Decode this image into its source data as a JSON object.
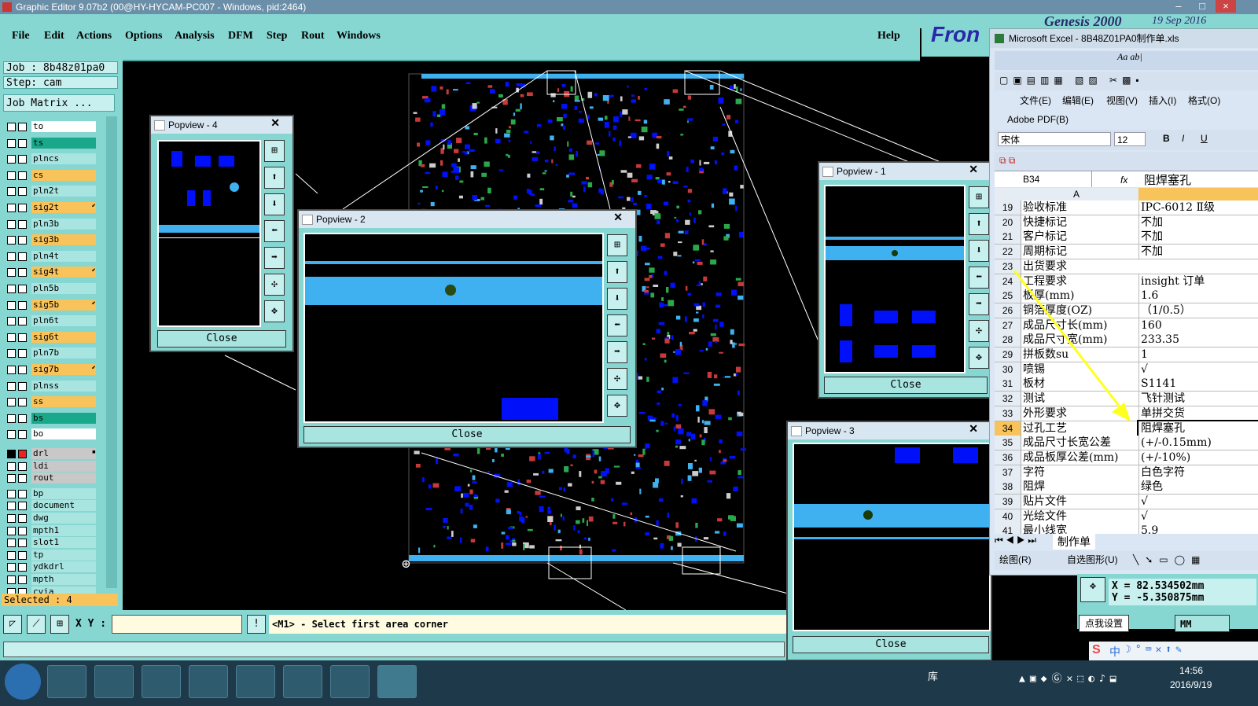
{
  "window": {
    "title": "Graphic Editor 9.07b2 (00@HY-HYCAM-PC007 - Windows, pid:2464)"
  },
  "menu": {
    "items": [
      "File",
      "Edit",
      "Actions",
      "Options",
      "Analysis",
      "DFM",
      "Step",
      "Rout",
      "Windows"
    ],
    "help": "Help"
  },
  "brand": {
    "logo": "Fron",
    "banner": "Genesis 2000",
    "date": "19 Sep 2016"
  },
  "left_panel": {
    "job": "Job : 8b48z01pa0",
    "step": "Step: cam",
    "job_matrix": "Job Matrix ...",
    "selected": "Selected : 4",
    "layers": [
      {
        "name": "to",
        "color": "#ffffff",
        "mark": ""
      },
      {
        "name": "ts",
        "color": "#1aa88a",
        "mark": ""
      },
      {
        "name": "plncs",
        "color": "#a8e4e0",
        "mark": ""
      },
      {
        "name": "cs",
        "color": "#f7c35a",
        "mark": ""
      },
      {
        "name": "pln2t",
        "color": "#a8e4e0",
        "mark": ""
      },
      {
        "name": "sig2t",
        "color": "#f7c35a",
        "mark": "⬋"
      },
      {
        "name": "pln3b",
        "color": "#a8e4e0",
        "mark": ""
      },
      {
        "name": "sig3b",
        "color": "#f7c35a",
        "mark": ""
      },
      {
        "name": "pln4t",
        "color": "#a8e4e0",
        "mark": ""
      },
      {
        "name": "sig4t",
        "color": "#f7c35a",
        "mark": "⬋"
      },
      {
        "name": "pln5b",
        "color": "#a8e4e0",
        "mark": ""
      },
      {
        "name": "sig5b",
        "color": "#f7c35a",
        "mark": "⬋"
      },
      {
        "name": "pln6t",
        "color": "#a8e4e0",
        "mark": ""
      },
      {
        "name": "sig6t",
        "color": "#f7c35a",
        "mark": ""
      },
      {
        "name": "pln7b",
        "color": "#a8e4e0",
        "mark": ""
      },
      {
        "name": "sig7b",
        "color": "#f7c35a",
        "mark": "⬋"
      },
      {
        "name": "plnss",
        "color": "#a8e4e0",
        "mark": ""
      },
      {
        "name": "ss",
        "color": "#f7c35a",
        "mark": ""
      },
      {
        "name": "bs",
        "color": "#1aa88a",
        "mark": ""
      },
      {
        "name": "bo",
        "color": "#ffffff",
        "mark": ""
      },
      {
        "name": "drl",
        "color": "#c8c8c8",
        "mark": "▪"
      },
      {
        "name": "ldi",
        "color": "#c8c8c8",
        "mark": ""
      },
      {
        "name": "rout",
        "color": "#c8c8c8",
        "mark": ""
      },
      {
        "name": "bp",
        "color": "#a8e4e0",
        "mark": ""
      },
      {
        "name": "document",
        "color": "#a8e4e0",
        "mark": ""
      },
      {
        "name": "dwg",
        "color": "#a8e4e0",
        "mark": ""
      },
      {
        "name": "mpth1",
        "color": "#a8e4e0",
        "mark": ""
      },
      {
        "name": "slot1",
        "color": "#a8e4e0",
        "mark": ""
      },
      {
        "name": "tp",
        "color": "#a8e4e0",
        "mark": ""
      },
      {
        "name": "ydkdrl",
        "color": "#a8e4e0",
        "mark": ""
      },
      {
        "name": "mpth",
        "color": "#a8e4e0",
        "mark": ""
      },
      {
        "name": "cvia",
        "color": "#a8e4e0",
        "mark": ""
      }
    ]
  },
  "bottom": {
    "xy_label": "X Y :",
    "xy_value": "",
    "prompt": "<M1> - Select first area corner",
    "unit": "MM",
    "x_coord": "X = 82.534502mm",
    "y_coord": "Y = -5.350875mm",
    "tooltip": "点我设置"
  },
  "popviews": [
    {
      "title": "Popview - 4",
      "close": "Close"
    },
    {
      "title": "Popview - 2",
      "close": "Close"
    },
    {
      "title": "Popview - 1",
      "close": "Close"
    },
    {
      "title": "Popview - 3",
      "close": "Close"
    }
  ],
  "excel": {
    "title": "Microsoft Excel - 8B48Z01PA0制作单.xls",
    "menu": [
      "文件(E)",
      "编辑(E)",
      "视图(V)",
      "插入(I)",
      "格式(O)"
    ],
    "pdf": "Adobe PDF(B)",
    "font": "宋体",
    "size": "12",
    "namebox": "B34",
    "formula": "阻焊塞孔",
    "col_a": "A",
    "sheet_tab": "制作单",
    "draw": "绘图(R)",
    "autoshape": "自选图形(U)",
    "rows": [
      {
        "n": "19",
        "a": "验收标准",
        "b": "IPC-6012 Ⅱ级"
      },
      {
        "n": "20",
        "a": "快捷标记",
        "b": "不加"
      },
      {
        "n": "21",
        "a": "客户标记",
        "b": "不加"
      },
      {
        "n": "22",
        "a": "周期标记",
        "b": "不加"
      },
      {
        "n": "23",
        "a": "出货要求",
        "b": ""
      },
      {
        "n": "24",
        "a": "工程要求",
        "b": "insight 订单"
      },
      {
        "n": "25",
        "a": "板厚(mm)",
        "b": "1.6"
      },
      {
        "n": "26",
        "a": "铜箔厚度(OZ)",
        "b": "（1/0.5）"
      },
      {
        "n": "27",
        "a": "成品尺寸长(mm)",
        "b": "160"
      },
      {
        "n": "28",
        "a": "成品尺寸宽(mm)",
        "b": "233.35"
      },
      {
        "n": "29",
        "a": "拼板数su",
        "b": "1"
      },
      {
        "n": "30",
        "a": "喷锡",
        "b": "√"
      },
      {
        "n": "31",
        "a": "板材",
        "b": "S1141"
      },
      {
        "n": "32",
        "a": "测试",
        "b": "飞针测试"
      },
      {
        "n": "33",
        "a": "外形要求",
        "b": "单拼交货"
      },
      {
        "n": "34",
        "a": "过孔工艺",
        "b": "阻焊塞孔"
      },
      {
        "n": "35",
        "a": "成品尺寸长宽公差",
        "b": "(+/-0.15mm)"
      },
      {
        "n": "36",
        "a": "成品板厚公差(mm)",
        "b": "(+/-10%)"
      },
      {
        "n": "37",
        "a": "字符",
        "b": "白色字符"
      },
      {
        "n": "38",
        "a": "阻焊",
        "b": "绿色"
      },
      {
        "n": "39",
        "a": "贴片文件",
        "b": "√"
      },
      {
        "n": "40",
        "a": "光绘文件",
        "b": "√"
      },
      {
        "n": "41",
        "a": "最小线宽",
        "b": "5.9"
      }
    ]
  },
  "taskbar": {
    "clock_time": "14:56",
    "clock_date": "2016/9/19",
    "lib": "库",
    "ime": "中"
  },
  "colors": {
    "panel": "#86d6d2",
    "pad_blue": "#0010f8",
    "pad_cyan": "#3fb0f0",
    "highlight": "#f7c35a"
  }
}
